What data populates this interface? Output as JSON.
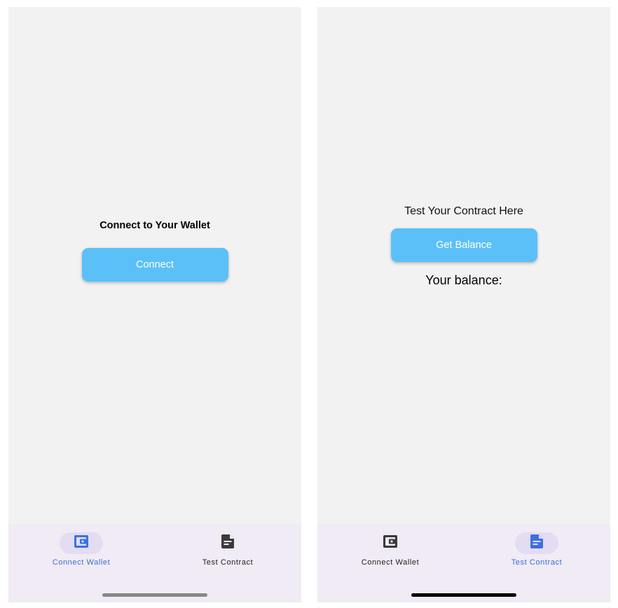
{
  "colors": {
    "screen_bg": "#f2f2f2",
    "button_bg": "#5bc0f8",
    "button_text": "#ffffff",
    "nav_bg": "#f0ebf4",
    "nav_active_pill": "#e3dcf3",
    "nav_active_icon": "#3b72e0",
    "nav_inactive_icon": "#3a3a3a"
  },
  "screen_left": {
    "title": "Connect to Your Wallet",
    "connect_button_label": "Connect",
    "nav": {
      "active_tab": "connect-wallet",
      "items": [
        {
          "id": "connect-wallet",
          "label": "Connect Wallet",
          "icon": "wallet-icon"
        },
        {
          "id": "test-contract",
          "label": "Test Contract",
          "icon": "document-icon"
        }
      ]
    }
  },
  "screen_right": {
    "title": "Test Your Contract Here",
    "get_balance_button_label": "Get Balance",
    "balance_label": "Your balance:",
    "nav": {
      "active_tab": "test-contract",
      "items": [
        {
          "id": "connect-wallet",
          "label": "Connect Wallet",
          "icon": "wallet-icon"
        },
        {
          "id": "test-contract",
          "label": "Test Contract",
          "icon": "document-icon"
        }
      ]
    }
  }
}
